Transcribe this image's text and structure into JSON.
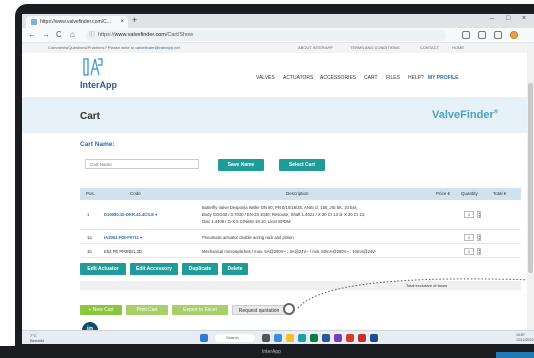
{
  "browser": {
    "tab_title": "https://www.valvefinder.com/C...",
    "tab_close": "×",
    "new_tab": "+",
    "url_prefix": "https://",
    "url_domain": "www.valvefinder.com",
    "url_path": "/Cart/Show",
    "nav_back": "←",
    "nav_forward": "→",
    "nav_reload": "C",
    "nav_home": "⌂",
    "info": "ⓘ",
    "min": "–",
    "max": "□",
    "close": "×"
  },
  "topstrip": {
    "contact_text": "Comments/Questions/Problems? Please write to ",
    "contact_email": "valvefinder@interapp.net",
    "links": [
      "ABOUT INTERAPP",
      "TERMS AND CONDITIONS",
      "CONTACT",
      "HOME"
    ]
  },
  "header": {
    "logo_text": "InterApp",
    "menu": [
      "VALVES",
      "ACTUATORS",
      "ACCESSORIES",
      "CART",
      "FILES",
      "HELP?",
      "MY PROFILE"
    ]
  },
  "title": {
    "page_title": "Cart",
    "brand": "ValveFinder",
    "brand_mark": "®"
  },
  "cart": {
    "name_label": "Cart Name:",
    "name_placeholder": "Cart Name",
    "save_button": "Save Name",
    "select_button": "Select Cart"
  },
  "table": {
    "headers": [
      "Pos.",
      "Code",
      "Description",
      "Price €",
      "Quantity",
      "Total €"
    ],
    "rows": [
      {
        "pos": "1",
        "code": "D10080.10-DKR.41.4CS.E ▾",
        "description": [
          "Butterfly Valve Desponia Wafer DN 80, PN 6/10/16/25, ANSI cl. 150, JIS 5K, 10 bar;",
          "Body GGG40 / 0.7040 / EN-JS 1030; Resouse; Shaft 1.4021 / X 30 Cr 13 or X 20 Cr 13;",
          "Disc 1.4408 / G-X 5 CrNiMo 19 10; Liner EPDM"
        ],
        "qty": "1"
      },
      {
        "pos": "1a",
        "code": "IA2002.F05-F0711 ▾",
        "description": [
          "Pneumatic actuator double acting rack and pinion"
        ],
        "qty": "1"
      },
      {
        "pos": "1b",
        "code": "E52 PE PP2NB1.3D",
        "description": [
          "Mechanical microswitches / max. 5A@250V~ ; 3A@24V-- / min. 50mA@250V~ ; 10mA@24V-"
        ],
        "qty": "1"
      }
    ],
    "spin_up": "▲",
    "spin_down": "▼"
  },
  "actions": [
    "Edit Actuator",
    "Edit Accessory",
    "Duplicate",
    "Delete"
  ],
  "totals": {
    "label": "Total exclusive of taxes"
  },
  "bottom_buttons": [
    "+ New Cart",
    "Print Cart",
    "Export to Excel",
    "Request quotation"
  ],
  "social": {
    "linkedin": "in"
  },
  "taskbar": {
    "weather_temp": "7°C",
    "weather_desc": "Bewölkt",
    "search": "Search",
    "tray_time": "10:57",
    "tray_date": "12/12/2023"
  },
  "laptop": {
    "label": "InterApp"
  },
  "colors": {
    "teal": "#1f9c98",
    "blue": "#2d6ab0",
    "light_band": "#e6f2f7",
    "table_head": "#cfe3ee",
    "green_button": "#8cc63f"
  }
}
